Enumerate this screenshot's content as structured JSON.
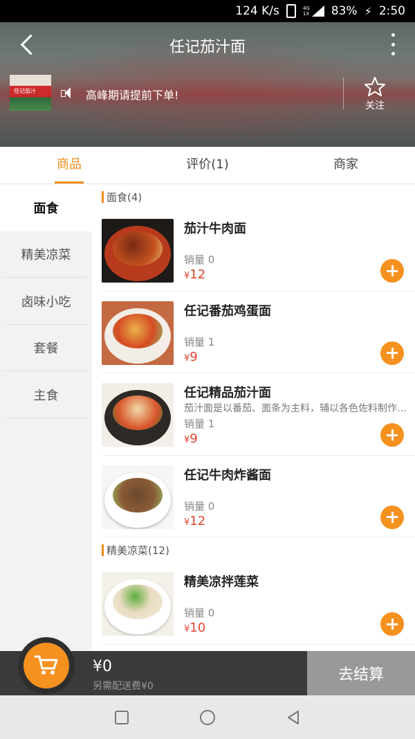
{
  "status_bar": {
    "speed": "124 K/s",
    "net_top": "4G",
    "net_bottom": "1X",
    "battery": "83%",
    "time": "2:50"
  },
  "header": {
    "title": "任记茄汁面",
    "notice": "高峰期请提前下单!",
    "follow_label": "关注",
    "shop_sign": "任记茄汁"
  },
  "tabs": [
    {
      "label": "商品"
    },
    {
      "label": "评价(1)"
    },
    {
      "label": "商家"
    }
  ],
  "sidebar": {
    "items": [
      {
        "label": "面食"
      },
      {
        "label": "精美凉菜"
      },
      {
        "label": "卤味小吃"
      },
      {
        "label": "套餐"
      },
      {
        "label": "主食"
      }
    ]
  },
  "sections": [
    {
      "title": "面食(4)"
    },
    {
      "title": "精美凉菜(12)"
    }
  ],
  "products": [
    {
      "name": "茄汁牛肉面",
      "desc": "",
      "sales": "销量 0",
      "currency": "¥",
      "price": "12"
    },
    {
      "name": "任记番茄鸡蛋面",
      "desc": "",
      "sales": "销量 1",
      "currency": "¥",
      "price": "9"
    },
    {
      "name": "任记精品茄汁面",
      "desc": "茄汁面是以番茄、面条为主料，辅以各色佐料制作而成",
      "sales": "销量 1",
      "currency": "¥",
      "price": "9"
    },
    {
      "name": "任记牛肉炸酱面",
      "desc": "",
      "sales": "销量 0",
      "currency": "¥",
      "price": "12"
    },
    {
      "name": "精美凉拌莲菜",
      "desc": "",
      "sales": "销量 0",
      "currency": "¥",
      "price": "10"
    }
  ],
  "cart": {
    "total": "¥0",
    "fee": "另需配送费¥0",
    "checkout_label": "去结算"
  },
  "colors": {
    "accent": "#f08c1a",
    "price": "#e2452f",
    "cart_bar": "#3a3a3a"
  }
}
